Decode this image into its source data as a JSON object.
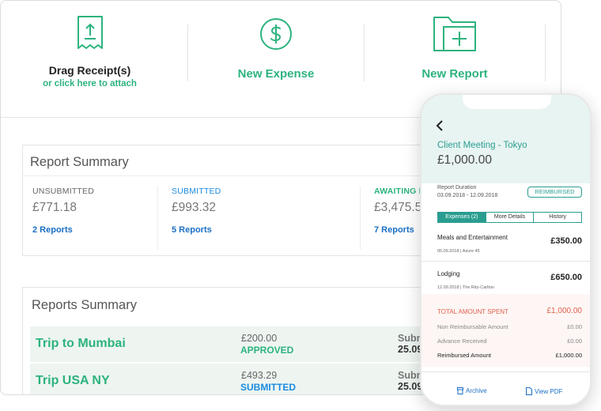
{
  "actions": {
    "upload": {
      "title": "Drag Receipt(s)",
      "subtitle": "or click here to attach"
    },
    "new_expense": {
      "title": "New Expense"
    },
    "new_report": {
      "title": "New Report"
    }
  },
  "report_summary": {
    "title": "Report Summary",
    "columns": [
      {
        "label": "UNSUBMITTED",
        "amount": "£771.18",
        "link": "2 Reports"
      },
      {
        "label": "SUBMITTED",
        "amount": "£993.32",
        "link": "5 Reports"
      },
      {
        "label": "AWAITING REIMBURSEMENT",
        "amount": "£3,475.52",
        "link": "7 Reports"
      }
    ]
  },
  "reports_summary": {
    "title": "Reports Summary",
    "rows": [
      {
        "name": "Trip to Mumbai",
        "amount": "£200.00",
        "status": "APPROVED",
        "status_color": "#2db37e",
        "submitted_label": "Submitted",
        "submitted_date": "25.09.2018"
      },
      {
        "name": "Trip USA NY",
        "amount": "£493.29",
        "status": "SUBMITTED",
        "status_color": "#1a8be0",
        "submitted_label": "Submitted",
        "submitted_date": "25.09.2018"
      }
    ]
  },
  "phone": {
    "title": "Client Meeting - Tokyo",
    "total": "£1,000.00",
    "duration_label": "Report Duration",
    "duration_value": "03.09.2018 - 12.09.2018",
    "badge": "REIMBURSED",
    "tabs": [
      "Expenses (2)",
      "More Details",
      "History"
    ],
    "expenses": [
      {
        "title": "Meals and Entertainment",
        "date": "05.09.2018",
        "merchant": "Azure 45",
        "amount": "£350.00"
      },
      {
        "title": "Lodging",
        "date": "12.09.2018",
        "merchant": "The Ritz-Carlton",
        "amount": "£650.00"
      }
    ],
    "summary": {
      "total_label": "TOTAL AMOUNT SPENT",
      "total_value": "£1,000.00",
      "non_reimb_label": "Non Reimbursable Amount",
      "non_reimb_value": "£0.00",
      "advance_label": "Advance Received",
      "advance_value": "£0.00",
      "reimb_label": "Reimbursed Amount",
      "reimb_value": "£1,000.00"
    },
    "footer": {
      "archive": "Archive",
      "view_pdf": "View PDF"
    }
  },
  "colors": {
    "accent_green": "#2db37e",
    "teal": "#2a9d90",
    "link_blue": "#1a6fc4",
    "total_red": "#e0604c"
  }
}
